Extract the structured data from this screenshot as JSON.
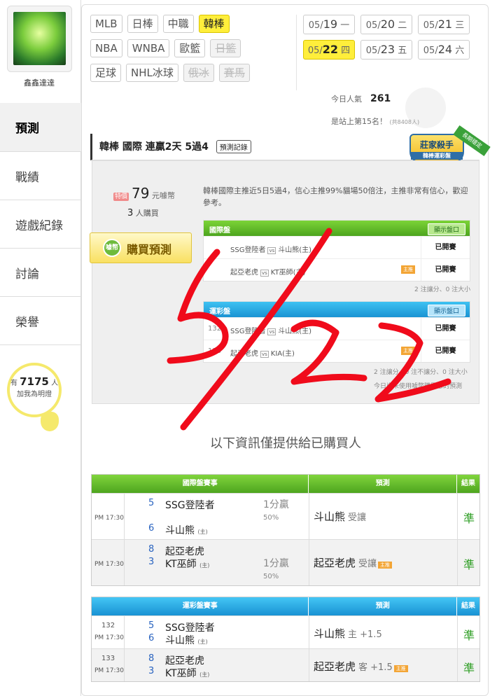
{
  "user": {
    "name": "鑫鑫達達"
  },
  "nav": [
    "預測",
    "戰績",
    "遊戲紀錄",
    "討論",
    "榮譽"
  ],
  "lamp": {
    "prefix": "有",
    "count": "7175",
    "suffix": "人",
    "label": "加我為明燈"
  },
  "sports": [
    [
      {
        "label": "MLB"
      },
      {
        "label": "日棒"
      },
      {
        "label": "中職"
      },
      {
        "label": "韓棒",
        "selected": true
      }
    ],
    [
      {
        "label": "NBA"
      },
      {
        "label": "WNBA"
      },
      {
        "label": "歐籃"
      },
      {
        "label": "日籃",
        "disabled": true
      }
    ],
    [
      {
        "label": "足球"
      },
      {
        "label": "NHL冰球"
      },
      {
        "label": "俄冰",
        "disabled": true
      },
      {
        "label": "賽馬",
        "disabled": true
      }
    ]
  ],
  "dates": [
    {
      "md": "05/",
      "d": "19",
      "w": "一"
    },
    {
      "md": "05/",
      "d": "20",
      "w": "二"
    },
    {
      "md": "05/",
      "d": "21",
      "w": "三"
    },
    {
      "md": "05/",
      "d": "22",
      "w": "四",
      "selected": true
    },
    {
      "md": "05/",
      "d": "23",
      "w": "五"
    },
    {
      "md": "05/",
      "d": "24",
      "w": "六"
    }
  ],
  "popularity": {
    "label": "今日人氣",
    "value": "261"
  },
  "rank": {
    "text": "是站上第15名！",
    "total": "(共8408人)"
  },
  "prediction": {
    "title": "韓棒 國際 連贏2天 5過4",
    "record_button": "預測記錄",
    "badge_title": "莊家殺手",
    "badge_sub": "韓棒運彩盤",
    "badge_ribbon": "長期穩定",
    "price_tag": "特價",
    "price": "79",
    "price_unit": "元噱幣",
    "buyers": "3",
    "buyers_label": "人購買",
    "buy_button": "購買預測",
    "coin_label": "噱幣",
    "description": "韓棒國際主推近5日5過4，信心主推99%貓場50倍注，主推非常有信心，歡迎參考。"
  },
  "intl_panel": {
    "title": "國際盤",
    "show": "顯示盤口",
    "rows": [
      {
        "home": "SSG登陸者",
        "away": "斗山熊(主)",
        "status": "已開賽"
      },
      {
        "home": "起亞老虎",
        "away": "KT巫師(主)",
        "status": "已開賽",
        "tag": "主推"
      }
    ],
    "note": "2 注讓分、0 注大小"
  },
  "sports_panel": {
    "title": "運彩盤",
    "show": "顯示盤口",
    "rows": [
      {
        "num": "132",
        "home": "SSG登陸者",
        "away": "斗山熊(主)",
        "status": "已開賽"
      },
      {
        "num": "133",
        "home": "起亞老虎",
        "away": "KIA(主)",
        "status": "已開賽",
        "tag": "主推"
      }
    ],
    "note": "2 注讓分、0 注不讓分、0 注大小",
    "footer": "今日尚未使用噱幣購買您的預測"
  },
  "only_text": "以下資訊僅提供給已購買人",
  "intl_table": {
    "headers": [
      "國際盤賽事",
      "預測",
      "結果"
    ],
    "rows": [
      {
        "time": "PM 17:30",
        "s1": "5",
        "t1": "SSG登陸者",
        "s2": "6",
        "t2": "斗山熊",
        "t2tag": "(主)",
        "odd1": "1分贏",
        "odd2": "50%",
        "pred": "斗山熊",
        "pred_extra": "受讓",
        "result": "準"
      },
      {
        "time": "PM 17:30",
        "s1": "8",
        "t1": "起亞老虎",
        "s2": "3",
        "t2": "KT巫師",
        "t2tag": "(主)",
        "odd1": "1分贏",
        "odd2": "50%",
        "pred": "起亞老虎",
        "pred_extra": "受讓",
        "tag": "主推",
        "result": "準"
      }
    ]
  },
  "sports_table": {
    "headers": [
      "運彩盤賽事",
      "預測",
      "結果"
    ],
    "rows": [
      {
        "num": "132",
        "time": "PM 17:30",
        "s1": "5",
        "t1": "SSG登陸者",
        "s2": "6",
        "t2": "斗山熊",
        "t2tag": "(主)",
        "pred": "斗山熊",
        "pred_extra": "主 +1.5",
        "result": "準"
      },
      {
        "num": "133",
        "time": "PM 17:30",
        "s1": "8",
        "t1": "起亞老虎",
        "s2": "3",
        "t2": "KT巫師",
        "t2tag": "(主)",
        "pred": "起亞老虎",
        "pred_extra": "客 +1.5",
        "tag": "主推",
        "result": "準"
      }
    ]
  },
  "colors": {
    "accent": "#ffee3b",
    "green": "#4ea51f",
    "blue": "#1992d3",
    "handwriting": "#f00b1b"
  }
}
